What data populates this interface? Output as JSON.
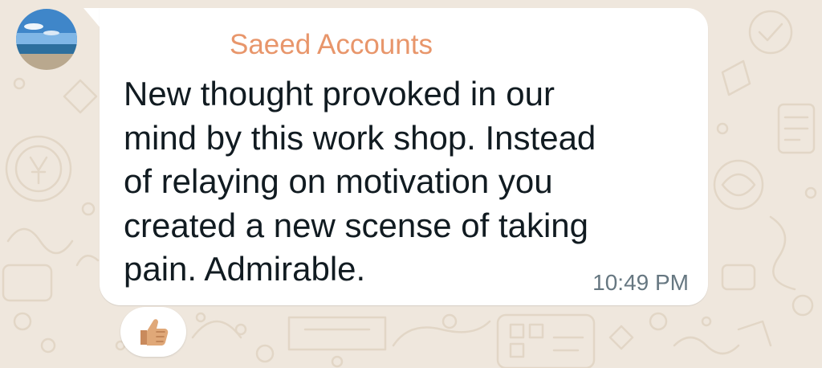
{
  "chat": {
    "sender_name": "Saeed Accounts",
    "avatar_icon": "beach-sky-avatar",
    "message_text": "New thought provoked in our\nmind by this work shop. Instead\nof relaying on motivation you\ncreated a new scense of taking\npain. Admirable.",
    "time": "10:49 PM",
    "reaction_icon": "thumbs-up-icon"
  },
  "colors": {
    "wallpaper": "#efe7dd",
    "bubble": "#ffffff",
    "sender_name": "#e8966b",
    "message_text": "#111b21",
    "timestamp": "#667781"
  }
}
